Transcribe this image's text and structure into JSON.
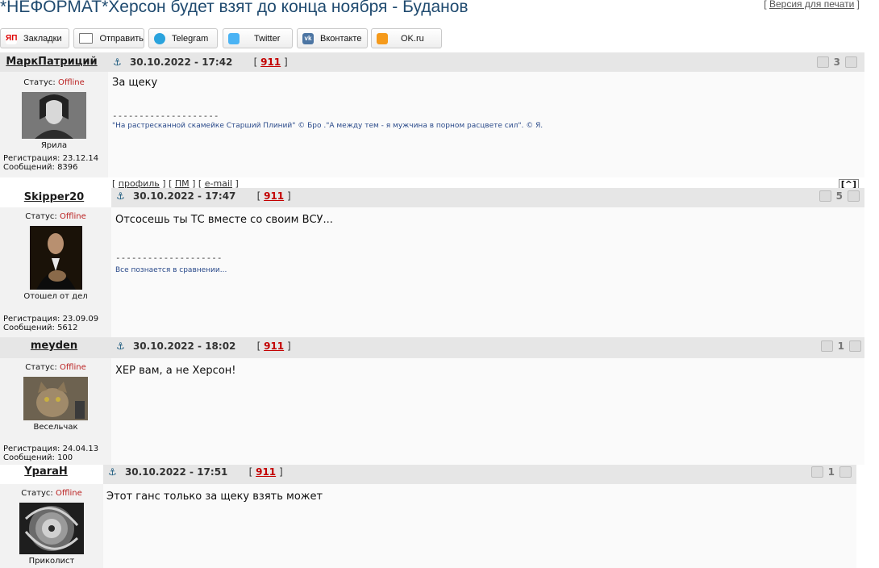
{
  "page": {
    "title": "*НЕФОРМАТ*Херсон будет взят до конца ноября - Буданов",
    "print_version": "Версия для печати"
  },
  "share": [
    {
      "label": "Закладки",
      "icon": "yandex-bookmarks-icon"
    },
    {
      "label": "Отправить",
      "icon": "mail-icon"
    },
    {
      "label": "Telegram",
      "icon": "telegram-icon"
    },
    {
      "label": "Twitter",
      "icon": "twitter-icon"
    },
    {
      "label": "Вконтакте",
      "icon": "vk-icon"
    },
    {
      "label": "OK.ru",
      "icon": "ok-icon"
    }
  ],
  "labels": {
    "status": "Статус:",
    "offline": "Offline",
    "reg_prefix": "Регистрация:",
    "posts_prefix": "Сообщений:",
    "profile": "профиль",
    "pm": "ПМ",
    "email": "e-mail",
    "up": "[^]"
  },
  "posts": [
    {
      "author": "МаркПатриций",
      "date": "30.10.2022 - 17:42",
      "ref": "911",
      "rating": "3",
      "rank": "Ярила",
      "registered": "23.12.14",
      "messages": "8396",
      "text": "За щеку",
      "sig_line": "--------------------",
      "signature": "\"На растресканной скамейке Старший Плиний\" © Бро .\"А между тем - я мужчина в порном расцвете сил\". © Я."
    },
    {
      "author": "Skipper20",
      "date": "30.10.2022 - 17:47",
      "ref": "911",
      "rating": "5",
      "rank": "Отошел от дел",
      "registered": "23.09.09",
      "messages": "5612",
      "text": "Отсосешь ты ТС вместе со своим ВСУ...",
      "sig_line": "--------------------",
      "signature": "Все познается в сравнении..."
    },
    {
      "author": "meyden",
      "date": "30.10.2022 - 18:02",
      "ref": "911",
      "rating": "1",
      "rank": "Весельчак",
      "registered": "24.04.13",
      "messages": "100",
      "text": "ХЕР вам, а не Херсон!"
    },
    {
      "author": "YparaH",
      "date": "30.10.2022 - 17:51",
      "ref": "911",
      "rating": "1",
      "rank": "Приколист",
      "text": "Этот ганс только за щеку взять может"
    }
  ]
}
